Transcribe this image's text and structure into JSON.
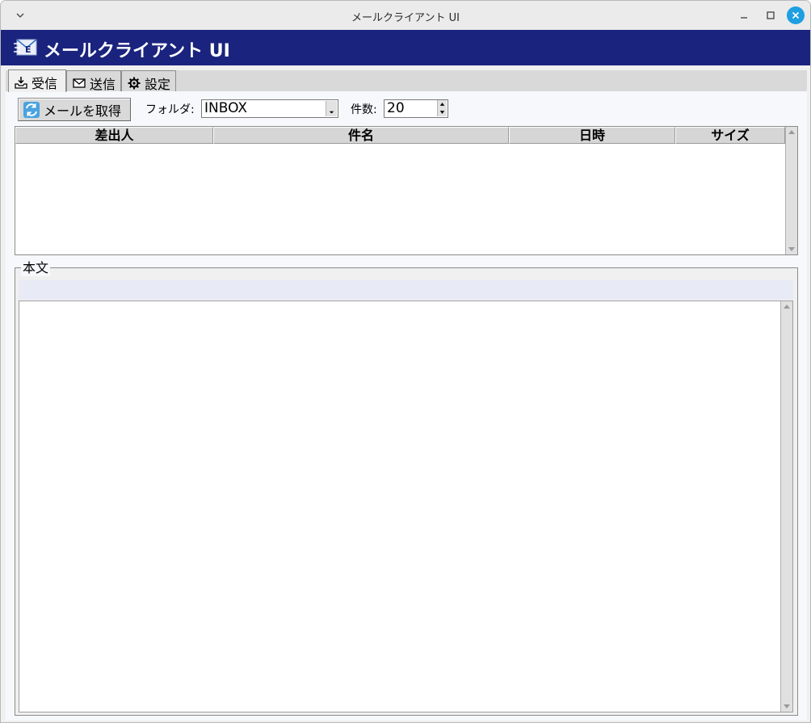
{
  "window": {
    "title": "メールクライアント UI"
  },
  "app": {
    "title": "メールクライアント UI"
  },
  "tabs": [
    {
      "label": "受信",
      "icon": "inbox-icon",
      "active": true
    },
    {
      "label": "送信",
      "icon": "envelope-icon",
      "active": false
    },
    {
      "label": "設定",
      "icon": "gear-icon",
      "active": false
    }
  ],
  "toolbar": {
    "fetch_label": "メールを取得",
    "folder_label": "フォルダ:",
    "folder_value": "INBOX",
    "count_label": "件数:",
    "count_value": "20"
  },
  "mail_list": {
    "columns": [
      "差出人",
      "件名",
      "日時",
      "サイズ"
    ],
    "rows": []
  },
  "body_panel": {
    "legend": "本文",
    "header_text": "",
    "text": ""
  },
  "colors": {
    "banner": "#1a237e",
    "close_button": "#1e9fe1"
  }
}
